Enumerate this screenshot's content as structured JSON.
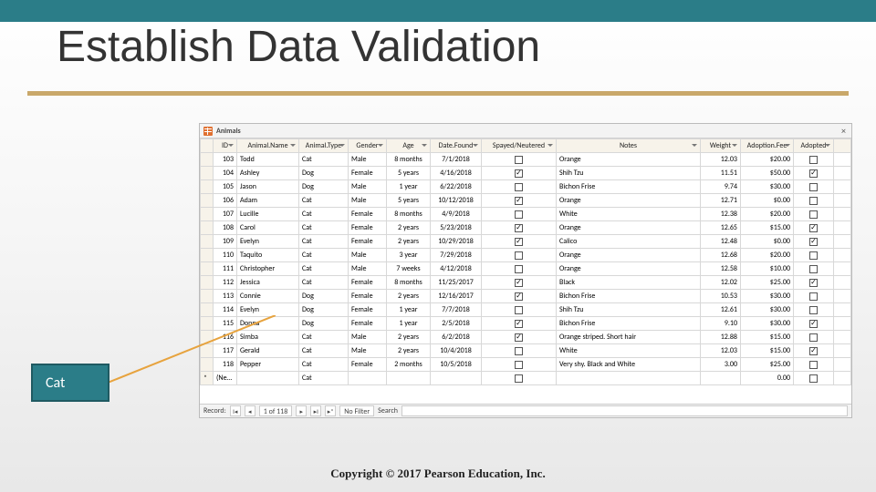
{
  "slide": {
    "title": "Establish Data Validation",
    "copyright": "Copyright © 2017 Pearson Education, Inc."
  },
  "callout": {
    "label": "Cat"
  },
  "datasheet": {
    "tab_name": "Animals",
    "close_label": "×",
    "nav": {
      "record_label": "Record:",
      "first": "I◂",
      "prev": "◂",
      "position": "1 of 118",
      "next": "▸",
      "last": "▸I",
      "new": "▸*",
      "no_filter": "No Filter",
      "search_label": "Search"
    },
    "columns": [
      "ID",
      "Animal.Name",
      "Animal.Type",
      "Gender",
      "Age",
      "Date.Found",
      "Spayed/Neutered",
      "Notes",
      "Weight",
      "Adoption.Fee",
      "Adopted"
    ],
    "new_row": {
      "label": "(New)",
      "type_default": "Cat",
      "weight_default": "",
      "fee_default": "0.00"
    },
    "rows": [
      {
        "id": 103,
        "name": "Todd",
        "type": "Cat",
        "gender": "Male",
        "age": "8 months",
        "date": "7/1/2018",
        "sn": false,
        "notes": "Orange",
        "weight": "12.03",
        "fee": "$20.00",
        "adopted": false
      },
      {
        "id": 104,
        "name": "Ashley",
        "type": "Dog",
        "gender": "Female",
        "age": "5 years",
        "date": "4/16/2018",
        "sn": true,
        "notes": "Shih Tzu",
        "weight": "11.51",
        "fee": "$50.00",
        "adopted": true
      },
      {
        "id": 105,
        "name": "Jason",
        "type": "Dog",
        "gender": "Male",
        "age": "1 year",
        "date": "6/22/2018",
        "sn": false,
        "notes": "Bichon Frise",
        "weight": "9.74",
        "fee": "$30.00",
        "adopted": false
      },
      {
        "id": 106,
        "name": "Adam",
        "type": "Cat",
        "gender": "Male",
        "age": "5 years",
        "date": "10/12/2018",
        "sn": true,
        "notes": "Orange",
        "weight": "12.71",
        "fee": "$0.00",
        "adopted": false
      },
      {
        "id": 107,
        "name": "Lucille",
        "type": "Cat",
        "gender": "Female",
        "age": "8 months",
        "date": "4/9/2018",
        "sn": false,
        "notes": "White",
        "weight": "12.38",
        "fee": "$20.00",
        "adopted": false
      },
      {
        "id": 108,
        "name": "Carol",
        "type": "Cat",
        "gender": "Female",
        "age": "2 years",
        "date": "5/23/2018",
        "sn": true,
        "notes": "Orange",
        "weight": "12.65",
        "fee": "$15.00",
        "adopted": true
      },
      {
        "id": 109,
        "name": "Evelyn",
        "type": "Cat",
        "gender": "Female",
        "age": "2 years",
        "date": "10/29/2018",
        "sn": true,
        "notes": "Calico",
        "weight": "12.48",
        "fee": "$0.00",
        "adopted": true
      },
      {
        "id": 110,
        "name": "Taquito",
        "type": "Cat",
        "gender": "Male",
        "age": "3 year",
        "date": "7/29/2018",
        "sn": false,
        "notes": "Orange",
        "weight": "12.68",
        "fee": "$20.00",
        "adopted": false
      },
      {
        "id": 111,
        "name": "Christopher",
        "type": "Cat",
        "gender": "Male",
        "age": "7 weeks",
        "date": "4/12/2018",
        "sn": false,
        "notes": "Orange",
        "weight": "12.58",
        "fee": "$10.00",
        "adopted": false
      },
      {
        "id": 112,
        "name": "Jessica",
        "type": "Cat",
        "gender": "Female",
        "age": "8 months",
        "date": "11/25/2017",
        "sn": true,
        "notes": "Black",
        "weight": "12.02",
        "fee": "$25.00",
        "adopted": true
      },
      {
        "id": 113,
        "name": "Connie",
        "type": "Dog",
        "gender": "Female",
        "age": "2 years",
        "date": "12/16/2017",
        "sn": true,
        "notes": "Bichon Frise",
        "weight": "10.53",
        "fee": "$30.00",
        "adopted": false
      },
      {
        "id": 114,
        "name": "Evelyn",
        "type": "Dog",
        "gender": "Female",
        "age": "1 year",
        "date": "7/7/2018",
        "sn": false,
        "notes": "Shih Tzu",
        "weight": "12.61",
        "fee": "$30.00",
        "adopted": false
      },
      {
        "id": 115,
        "name": "Donna",
        "type": "Dog",
        "gender": "Female",
        "age": "1 year",
        "date": "2/5/2018",
        "sn": true,
        "notes": "Bichon Frise",
        "weight": "9.10",
        "fee": "$30.00",
        "adopted": true
      },
      {
        "id": 116,
        "name": "Simba",
        "type": "Cat",
        "gender": "Male",
        "age": "2 years",
        "date": "6/2/2018",
        "sn": true,
        "notes": "Orange striped. Short hair",
        "weight": "12.88",
        "fee": "$15.00",
        "adopted": false
      },
      {
        "id": 117,
        "name": "Gerald",
        "type": "Cat",
        "gender": "Male",
        "age": "2 years",
        "date": "10/4/2018",
        "sn": false,
        "notes": "White",
        "weight": "12.03",
        "fee": "$15.00",
        "adopted": true
      },
      {
        "id": 118,
        "name": "Pepper",
        "type": "Cat",
        "gender": "Female",
        "age": "2 months",
        "date": "10/5/2018",
        "sn": false,
        "notes": "Very shy. Black and White",
        "weight": "3.00",
        "fee": "$25.00",
        "adopted": false
      }
    ]
  }
}
